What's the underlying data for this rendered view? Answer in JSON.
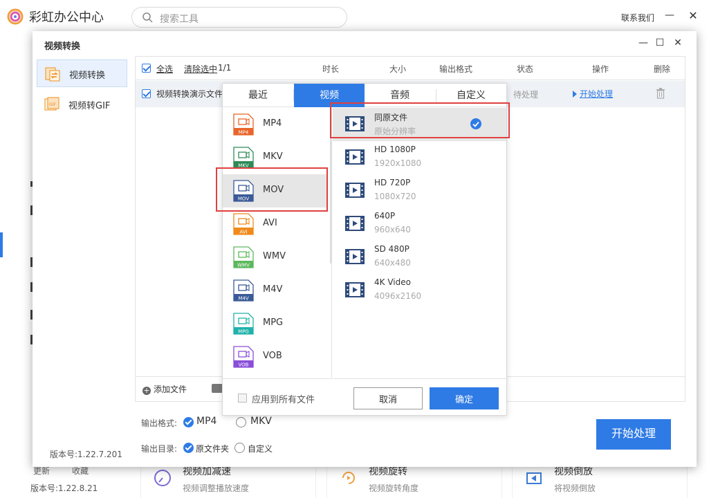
{
  "app": {
    "title": "彩虹办公中心",
    "search_placeholder": "搜索工具",
    "contact": "联系我们",
    "min_glyph": "—",
    "close_glyph": "✕",
    "bottom": {
      "update": "更新",
      "favorite": "收藏",
      "version": "版本号:1.22.8.21",
      "cards": [
        {
          "title": "视频加减速",
          "desc": "视频调整播放速度"
        },
        {
          "title": "视频旋转",
          "desc": "视频旋转角度"
        },
        {
          "title": "视频倒放",
          "desc": "将视频倒放"
        }
      ]
    }
  },
  "modal": {
    "title": "视频转换",
    "sidebar": [
      {
        "label": "视频转换",
        "active": true
      },
      {
        "label": "视频转GIF",
        "active": false
      }
    ],
    "version": "版本号:1.22.7.201",
    "table": {
      "select_all": "全选",
      "clear_selected": "清除选中",
      "count": "1/1",
      "columns": [
        "时长",
        "大小",
        "输出格式",
        "状态",
        "操作",
        "删除"
      ],
      "rows": [
        {
          "name": "视频转换演示文件",
          "status": "待处理",
          "action": "开始处理"
        }
      ]
    },
    "add_file": "添加文件",
    "output_format_label": "输出格式:",
    "output_formats": [
      {
        "label": "MP4",
        "selected": true
      },
      {
        "label": "MKV",
        "selected": false
      }
    ],
    "output_dir_label": "输出目录:",
    "output_dirs": [
      {
        "label": "原文件夹",
        "selected": true
      },
      {
        "label": "自定义",
        "selected": false
      }
    ],
    "start_button": "开始处理"
  },
  "format_panel": {
    "tabs": [
      {
        "label": "最近",
        "active": false
      },
      {
        "label": "视频",
        "active": true
      },
      {
        "label": "音频",
        "active": false
      },
      {
        "label": "自定义",
        "active": false
      }
    ],
    "formats": [
      {
        "name": "MP4",
        "tag": "MP4",
        "color": "#e8652a",
        "selected": false
      },
      {
        "name": "MKV",
        "tag": "MKV",
        "color": "#2e8b57",
        "selected": false
      },
      {
        "name": "MOV",
        "tag": "MOV",
        "color": "#3a5a98",
        "selected": true
      },
      {
        "name": "AVI",
        "tag": "AVI",
        "color": "#f08a1c",
        "selected": false
      },
      {
        "name": "WMV",
        "tag": "WMV",
        "color": "#5cb85c",
        "selected": false
      },
      {
        "name": "M4V",
        "tag": "M4V",
        "color": "#3a5a98",
        "selected": false
      },
      {
        "name": "MPG",
        "tag": "MPG",
        "color": "#20b2aa",
        "selected": false
      },
      {
        "name": "VOB",
        "tag": "VOB",
        "color": "#8a4fd8",
        "selected": false
      }
    ],
    "resolutions": [
      {
        "title": "同原文件",
        "sub": "原始分辨率",
        "selected": true
      },
      {
        "title": "HD 1080P",
        "sub": "1920x1080",
        "selected": false
      },
      {
        "title": "HD 720P",
        "sub": "1080x720",
        "selected": false
      },
      {
        "title": "640P",
        "sub": "960x640",
        "selected": false
      },
      {
        "title": "SD 480P",
        "sub": "640x480",
        "selected": false
      },
      {
        "title": "4K Video",
        "sub": "4096x2160",
        "selected": false
      }
    ],
    "apply_all": "应用到所有文件",
    "cancel": "取消",
    "confirm": "确定"
  },
  "colors": {
    "accent": "#2f7be5",
    "highlight": "#e04040"
  }
}
